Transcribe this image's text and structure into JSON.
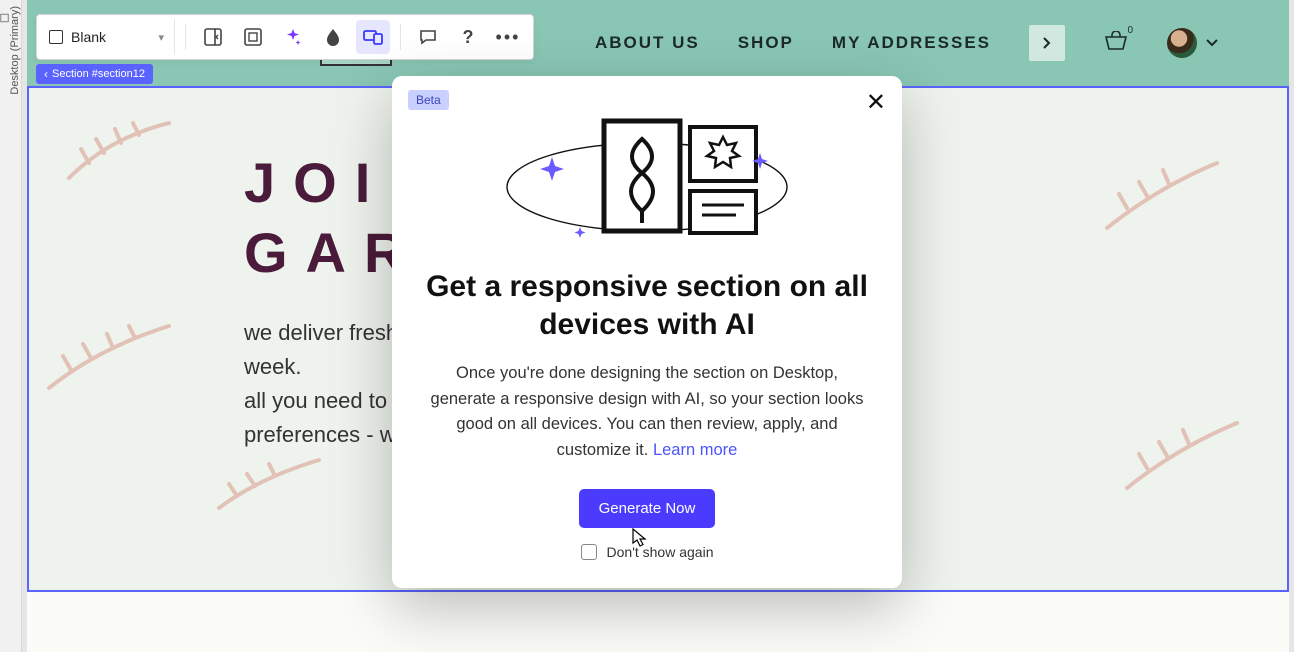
{
  "rail": {
    "label": "Desktop (Primary)"
  },
  "toolbar": {
    "select_label": "Blank"
  },
  "section_tag": "Section #section12",
  "nav": {
    "items": [
      "ABOUT US",
      "SHOP",
      "MY ADDRESSES"
    ],
    "cart_count": "0"
  },
  "hero": {
    "title_line1": "JOIN",
    "title_line2": "GAR",
    "para1": "we deliver fresh",
    "para1b": "week.",
    "para2": "all you need to d",
    "para3": "preferences - w"
  },
  "modal": {
    "badge": "Beta",
    "title": "Get a responsive section on all devices with AI",
    "body": "Once you're done designing the section on Desktop, generate a responsive design with AI, so your section looks good on all devices. You can then review, apply, and customize it. ",
    "learn_more": "Learn more",
    "button": "Generate Now",
    "checkbox": "Don't show again"
  }
}
